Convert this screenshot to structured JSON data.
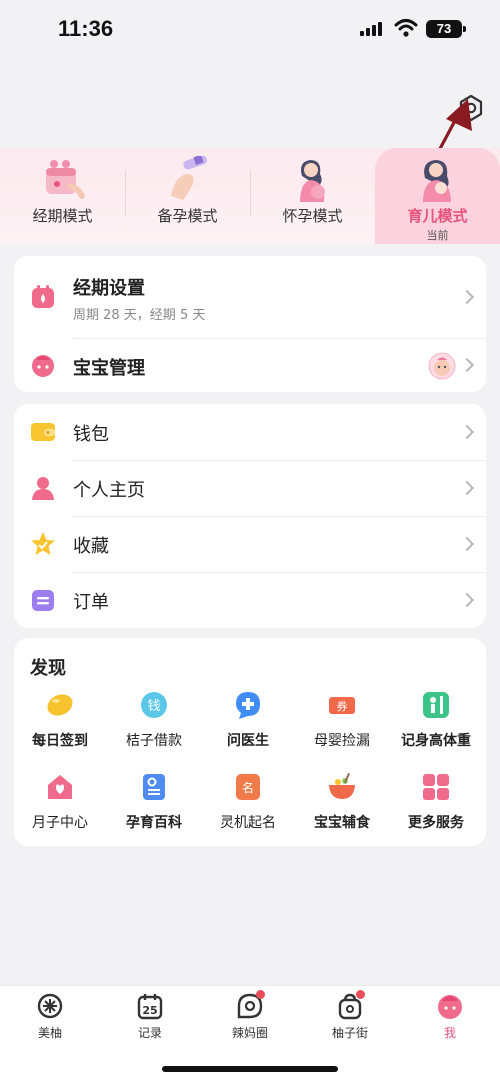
{
  "status": {
    "time": "11:36",
    "battery": "73"
  },
  "modes": [
    {
      "label": "经期模式"
    },
    {
      "label": "备孕模式"
    },
    {
      "label": "怀孕模式"
    },
    {
      "label": "育儿模式",
      "sub": "当前",
      "active": true
    }
  ],
  "card1": {
    "period": {
      "title": "经期设置",
      "subtitle": "周期 28 天，经期 5 天"
    },
    "baby": {
      "title": "宝宝管理"
    }
  },
  "card2": [
    {
      "title": "钱包"
    },
    {
      "title": "个人主页"
    },
    {
      "title": "收藏"
    },
    {
      "title": "订单"
    }
  ],
  "discover": {
    "title": "发现",
    "items": [
      {
        "label": "每日签到",
        "icon": "bean-icon"
      },
      {
        "label": "桔子借款",
        "icon": "money-icon"
      },
      {
        "label": "问医生",
        "icon": "doctor-icon"
      },
      {
        "label": "母婴捡漏",
        "icon": "coupon-icon"
      },
      {
        "label": "记身高体重",
        "icon": "height-icon"
      },
      {
        "label": "月子中心",
        "icon": "house-icon"
      },
      {
        "label": "孕育百科",
        "icon": "book-icon"
      },
      {
        "label": "灵机起名",
        "icon": "name-icon"
      },
      {
        "label": "宝宝辅食",
        "icon": "bowl-icon"
      },
      {
        "label": "更多服务",
        "icon": "grid-icon"
      }
    ]
  },
  "tabs": [
    {
      "label": "美柚"
    },
    {
      "label": "记录",
      "badge_text": "25"
    },
    {
      "label": "辣妈圈"
    },
    {
      "label": "柚子街"
    },
    {
      "label": "我"
    }
  ],
  "colors": {
    "accent": "#e8537c",
    "background": "#f2f2f4"
  }
}
